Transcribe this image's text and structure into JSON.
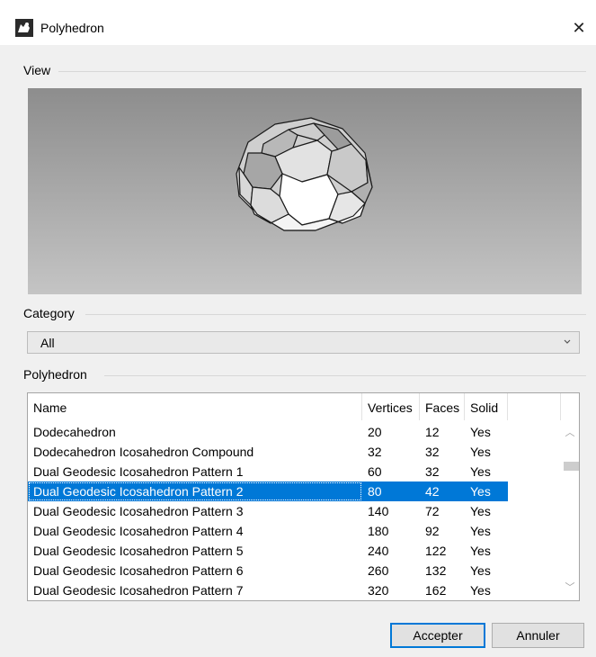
{
  "window": {
    "title": "Polyhedron",
    "close_glyph": "✕"
  },
  "view": {
    "label": "View"
  },
  "category": {
    "label": "Category",
    "selected": "All"
  },
  "polyhedron": {
    "label": "Polyhedron",
    "columns": [
      "Name",
      "Vertices",
      "Faces",
      "Solid"
    ],
    "rows": [
      {
        "name": "Dodecahedron",
        "vertices": "20",
        "faces": "12",
        "solid": "Yes"
      },
      {
        "name": "Dodecahedron Icosahedron Compound",
        "vertices": "32",
        "faces": "32",
        "solid": "Yes"
      },
      {
        "name": "Dual Geodesic Icosahedron Pattern 1",
        "vertices": "60",
        "faces": "32",
        "solid": "Yes"
      },
      {
        "name": "Dual Geodesic Icosahedron Pattern 2",
        "vertices": "80",
        "faces": "42",
        "solid": "Yes",
        "selected": true
      },
      {
        "name": "Dual Geodesic Icosahedron Pattern 3",
        "vertices": "140",
        "faces": "72",
        "solid": "Yes"
      },
      {
        "name": "Dual Geodesic Icosahedron Pattern 4",
        "vertices": "180",
        "faces": "92",
        "solid": "Yes"
      },
      {
        "name": "Dual Geodesic Icosahedron Pattern 5",
        "vertices": "240",
        "faces": "122",
        "solid": "Yes"
      },
      {
        "name": "Dual Geodesic Icosahedron Pattern 6",
        "vertices": "260",
        "faces": "132",
        "solid": "Yes"
      },
      {
        "name": "Dual Geodesic Icosahedron Pattern 7",
        "vertices": "320",
        "faces": "162",
        "solid": "Yes"
      }
    ]
  },
  "buttons": {
    "accept": "Accepter",
    "cancel": "Annuler"
  },
  "colors": {
    "selection": "#0078d7",
    "accent_border": "#0078d7"
  }
}
